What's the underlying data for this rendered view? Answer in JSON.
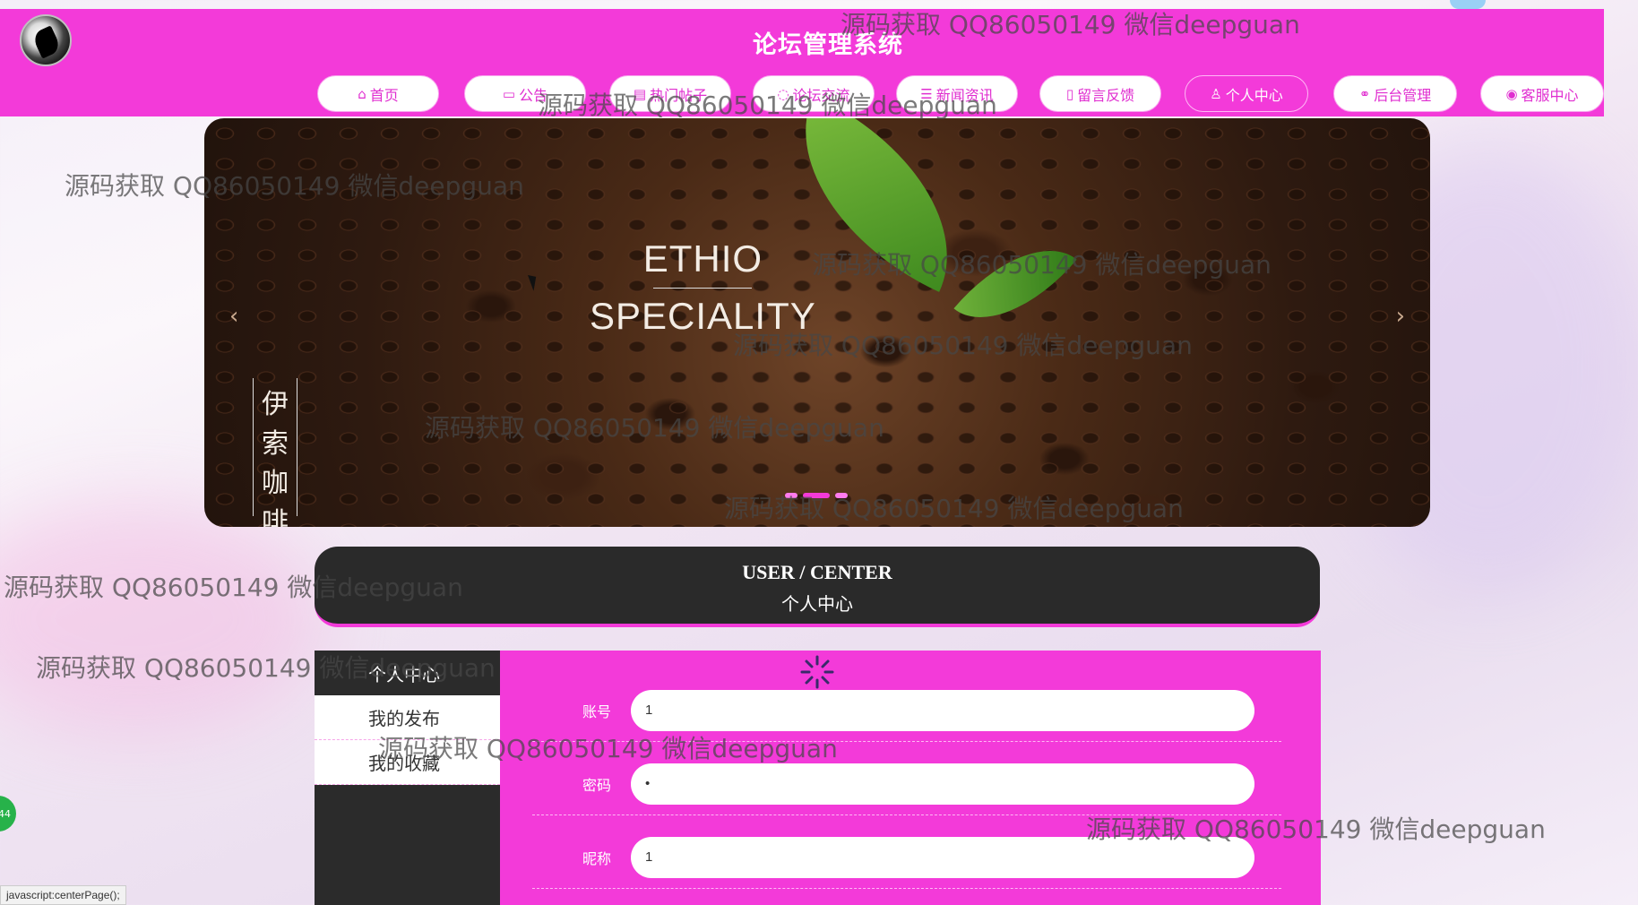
{
  "header": {
    "title": "论坛管理系统",
    "nav": [
      {
        "label": "首页",
        "icon": "home-icon"
      },
      {
        "label": "公告",
        "icon": "book-icon"
      },
      {
        "label": "热门帖子",
        "icon": "doc-icon"
      },
      {
        "label": "论坛交流",
        "icon": "chat-icon"
      },
      {
        "label": "新闻资讯",
        "icon": "list-icon"
      },
      {
        "label": "留言反馈",
        "icon": "note-icon"
      },
      {
        "label": "个人中心",
        "icon": "user-icon",
        "active": true
      },
      {
        "label": "后台管理",
        "icon": "link-icon"
      },
      {
        "label": "客服中心",
        "icon": "service-icon"
      }
    ]
  },
  "banner": {
    "title_line1": "ETHIO",
    "title_line2": "SPECIALITY",
    "vertical_text": [
      "伊",
      "索",
      "咖",
      "啡"
    ],
    "prev_label": "‹",
    "next_label": "›"
  },
  "section": {
    "title_en": "USER / CENTER",
    "title_cn": "个人中心"
  },
  "sidebar": {
    "items": [
      {
        "label": "个人中心"
      },
      {
        "label": "我的发布"
      },
      {
        "label": "我的收藏"
      }
    ]
  },
  "form": {
    "fields": [
      {
        "label": "账号",
        "value": "1"
      },
      {
        "label": "密码",
        "value": "•"
      },
      {
        "label": "昵称",
        "value": "1"
      }
    ]
  },
  "watermark": "源码获取 QQ86050149 微信deepguan",
  "status_bar": {
    "url": "javascript:centerPage();"
  },
  "badge": {
    "text": "44"
  },
  "colors": {
    "brand": "#f33ad9",
    "dark": "#2a2a2a",
    "accent_light": "#ffb8f5"
  }
}
